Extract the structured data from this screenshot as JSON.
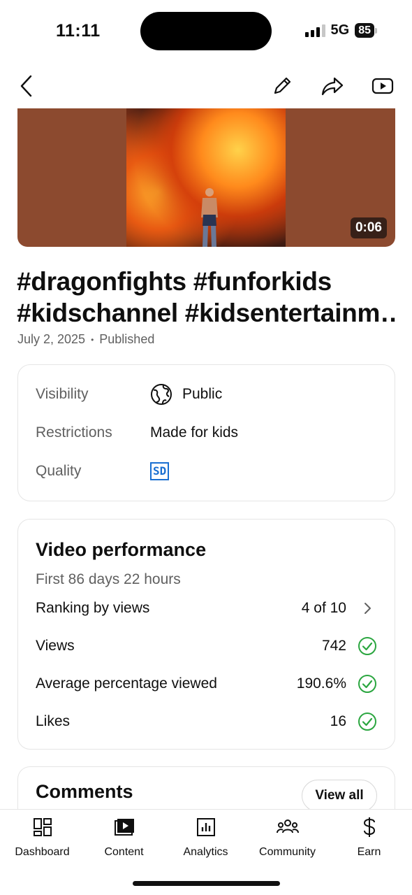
{
  "status_bar": {
    "time": "11:11",
    "network": "5G",
    "battery": "85",
    "signal_bars_filled": 3,
    "signal_bars_total": 4
  },
  "top_nav": {
    "icons": [
      "back-chevron-icon",
      "pencil-icon",
      "share-arrow-icon",
      "youtube-play-icon"
    ]
  },
  "video": {
    "duration": "0:06",
    "title_line1": "#dragonfights #funforkids",
    "title_line2": "#kidschannel #kidsentertainm…",
    "date": "July 2, 2025",
    "separator": "•",
    "status": "Published"
  },
  "details": {
    "visibility_label": "Visibility",
    "visibility_value": "Public",
    "visibility_icon": "globe-icon",
    "restrictions_label": "Restrictions",
    "restrictions_value": "Made for kids",
    "quality_label": "Quality",
    "quality_value": "SD"
  },
  "performance": {
    "title": "Video performance",
    "subtitle": "First 86 days 22 hours",
    "rows": [
      {
        "label": "Ranking by views",
        "value": "4 of 10",
        "icon": "chevron-right-icon"
      },
      {
        "label": "Views",
        "value": "742",
        "icon": "check-circle-icon"
      },
      {
        "label": "Average percentage viewed",
        "value": "190.6%",
        "icon": "check-circle-icon"
      },
      {
        "label": "Likes",
        "value": "16",
        "icon": "check-circle-icon"
      }
    ]
  },
  "comments": {
    "title": "Comments",
    "view_all": "View all"
  },
  "tab_bar": {
    "tabs": [
      {
        "label": "Dashboard",
        "icon": "dashboard-grid-icon"
      },
      {
        "label": "Content",
        "icon": "content-play-icon"
      },
      {
        "label": "Analytics",
        "icon": "analytics-bars-icon"
      },
      {
        "label": "Community",
        "icon": "community-people-icon"
      },
      {
        "label": "Earn",
        "icon": "dollar-icon"
      }
    ]
  },
  "colors": {
    "accent_green": "#2ba640",
    "sd_blue": "#1a6fd1",
    "secondary_text": "#606060"
  }
}
